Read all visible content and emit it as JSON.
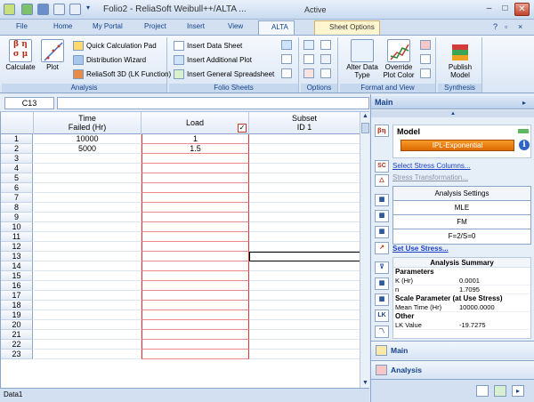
{
  "window": {
    "title": "Folio2 - ReliaSoft Weibull++/ALTA ...",
    "state": "Active",
    "controls": {
      "minimize": "–",
      "maximize": "□",
      "close": "✕"
    }
  },
  "ribbon_tabs": [
    {
      "label": "File"
    },
    {
      "label": "Home"
    },
    {
      "label": "My Portal"
    },
    {
      "label": "Project"
    },
    {
      "label": "Insert"
    },
    {
      "label": "View"
    },
    {
      "label": "ALTA"
    },
    {
      "label": "Sheet Options"
    }
  ],
  "ribbon": {
    "analysis": {
      "label": "Analysis",
      "calculate": "Calculate",
      "plot": "Plot",
      "quick_calc": "Quick Calculation Pad",
      "distribution_wizard": "Distribution Wizard",
      "reliasoft_3d": "ReliaSoft 3D (LK Function)"
    },
    "folio_sheets": {
      "label": "Folio Sheets",
      "insert_data_sheet": "Insert Data Sheet",
      "insert_additional_plot": "Insert Additional Plot",
      "insert_general_spreadsheet": "Insert General Spreadsheet"
    },
    "options": {
      "label": "Options"
    },
    "format_view": {
      "label": "Format and View",
      "alter_data_type": "Alter Data Type",
      "override_plot_color": "Override Plot Color"
    },
    "synthesis": {
      "label": "Synthesis",
      "publish_model": "Publish Model"
    }
  },
  "name_box": "C13",
  "grid": {
    "columns": [
      {
        "line1": "Time",
        "line2": "Failed (Hr)"
      },
      {
        "line1": "Load",
        "line2": ""
      },
      {
        "line1": "Subset",
        "line2": "ID 1"
      }
    ],
    "rows": [
      [
        "10000",
        "1",
        ""
      ],
      [
        "5000",
        "1.5",
        ""
      ],
      [
        "",
        "",
        ""
      ],
      [
        "",
        "",
        ""
      ],
      [
        "",
        "",
        ""
      ],
      [
        "",
        "",
        ""
      ],
      [
        "",
        "",
        ""
      ],
      [
        "",
        "",
        ""
      ],
      [
        "",
        "",
        ""
      ],
      [
        "",
        "",
        ""
      ],
      [
        "",
        "",
        ""
      ],
      [
        "",
        "",
        ""
      ],
      [
        "",
        "",
        ""
      ],
      [
        "",
        "",
        ""
      ],
      [
        "",
        "",
        ""
      ],
      [
        "",
        "",
        ""
      ],
      [
        "",
        "",
        ""
      ],
      [
        "",
        "",
        ""
      ],
      [
        "",
        "",
        ""
      ],
      [
        "",
        "",
        ""
      ],
      [
        "",
        "",
        ""
      ],
      [
        "",
        "",
        ""
      ],
      [
        "",
        "",
        ""
      ]
    ],
    "row_numbers": [
      "1",
      "2",
      "3",
      "4",
      "5",
      "6",
      "7",
      "8",
      "9",
      "10",
      "11",
      "12",
      "13",
      "14",
      "15",
      "16",
      "17",
      "18",
      "19",
      "20",
      "21",
      "22",
      "23"
    ],
    "selected_cell": "C13",
    "load_checked": "✓"
  },
  "sheet_tab": "Data1",
  "panel": {
    "header": "Main",
    "model_label": "Model",
    "model_value": "IPL-Exponential",
    "select_stress_columns": "Select Stress Columns...",
    "stress_transformation": "Stress Transformation...",
    "analysis_settings": [
      "Analysis Settings",
      "MLE",
      "FM",
      "F=2/S=0"
    ],
    "set_use_stress": "Set Use Stress...",
    "summary": {
      "title": "Analysis Summary",
      "parameters_label": "Parameters",
      "params": [
        {
          "key": "K (Hr)",
          "value": "0.0001"
        },
        {
          "key": "n",
          "value": "1.7095"
        }
      ],
      "scale_label": "Scale Parameter (at Use Stress)",
      "scale": [
        {
          "key": "Mean Time (Hr)",
          "value": "10000.0000"
        }
      ],
      "other_label": "Other",
      "other": [
        {
          "key": "LK Value",
          "value": "-19.7275"
        }
      ]
    },
    "nav_main": "Main",
    "nav_analysis": "Analysis"
  },
  "colors": {
    "accent": "#15428b",
    "load_border": "#e03232",
    "model_orange": "#f08a1c",
    "link": "#1a3fc7"
  }
}
